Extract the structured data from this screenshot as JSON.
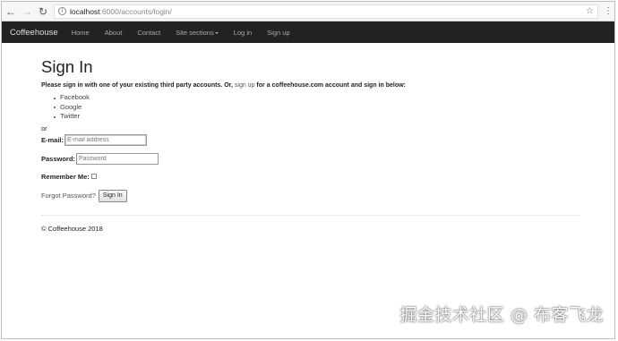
{
  "browser": {
    "back_icon": "back-arrow",
    "forward_icon": "forward-arrow",
    "reload_icon": "reload",
    "url_host": "localhost",
    "url_path": ":6000/accounts/login/",
    "star_icon": "star",
    "menu_icon": "vertical-dots"
  },
  "navbar": {
    "brand": "Coffeehouse",
    "items": [
      {
        "label": "Home"
      },
      {
        "label": "About"
      },
      {
        "label": "Contact"
      },
      {
        "label": "Site sections",
        "dropdown": true
      },
      {
        "label": "Log in"
      },
      {
        "label": "Sign up"
      }
    ]
  },
  "page": {
    "title": "Sign In",
    "intro_before": "Please sign in with one of your existing third party accounts. Or, ",
    "intro_link": "sign up",
    "intro_after": " for a coffeehouse.com account and sign in below:",
    "providers": [
      "Facebook",
      "Google",
      "Twitter"
    ],
    "or_text": "or",
    "email_label": "E-mail:",
    "email_placeholder": "E-mail address",
    "password_label": "Password:",
    "password_placeholder": "Password",
    "remember_label": "Remember Me:",
    "remember_checked": false,
    "forgot_link": "Forgot Password?",
    "signin_button": "Sign In"
  },
  "footer": {
    "copyright": "© Coffeehouse 2018"
  },
  "watermark": "掘金技术社区 @ 布客飞龙"
}
